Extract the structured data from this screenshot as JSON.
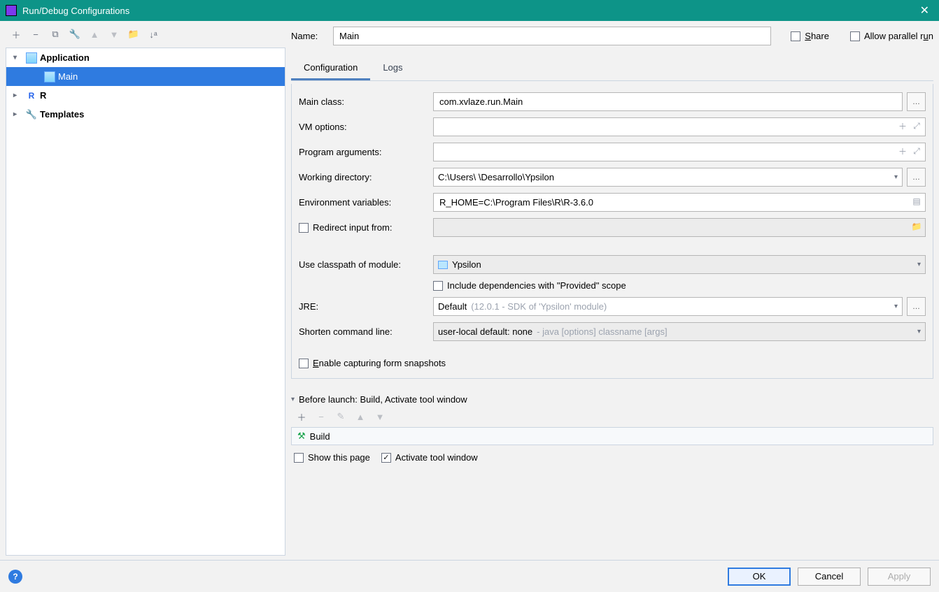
{
  "title": "Run/Debug Configurations",
  "tree": {
    "application": "Application",
    "main": "Main",
    "r": "R",
    "templates": "Templates"
  },
  "header": {
    "name_label": "Name:",
    "name_value": "Main",
    "share": "Share",
    "allow_parallel": "Allow parallel run"
  },
  "tabs": {
    "configuration": "Configuration",
    "logs": "Logs"
  },
  "form": {
    "main_class_label": "Main class:",
    "main_class_value": "com.xvlaze.run.Main",
    "vm_label": "VM options:",
    "vm_value": "",
    "args_label": "Program arguments:",
    "args_value": "",
    "workdir_label": "Working directory:",
    "workdir_value": "C:\\Users\\        \\Desarrollo\\Ypsilon",
    "env_label": "Environment variables:",
    "env_value": "R_HOME=C:\\Program Files\\R\\R-3.6.0",
    "redirect_label": "Redirect input from:",
    "module_label": "Use classpath of module:",
    "module_value": "Ypsilon",
    "include_provided": "Include dependencies with \"Provided\" scope",
    "jre_label": "JRE:",
    "jre_value": "Default",
    "jre_hint": "(12.0.1 - SDK of 'Ypsilon' module)",
    "shorten_label": "Shorten command line:",
    "shorten_value": "user-local default: none",
    "shorten_hint": "- java [options] classname [args]",
    "snapshots": "Enable capturing form snapshots"
  },
  "before_launch": {
    "header": "Before launch: Build, Activate tool window",
    "build": "Build",
    "show_page": "Show this page",
    "activate": "Activate tool window"
  },
  "footer": {
    "ok": "OK",
    "cancel": "Cancel",
    "apply": "Apply"
  }
}
